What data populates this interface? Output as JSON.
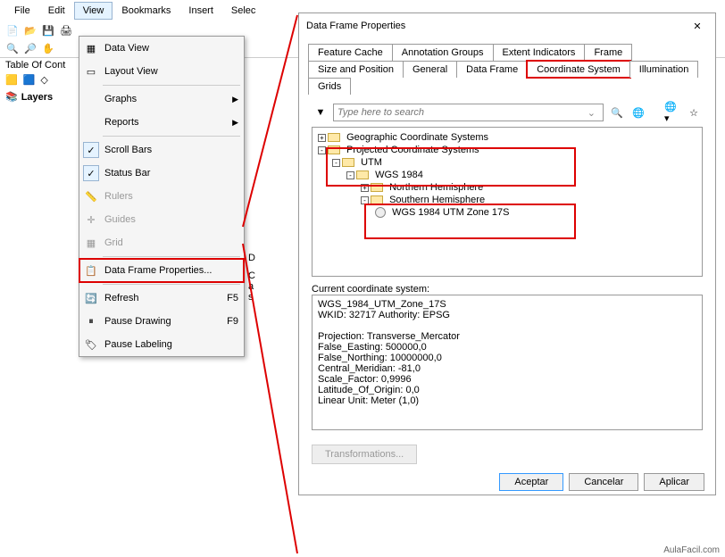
{
  "menubar": {
    "file": "File",
    "edit": "Edit",
    "view": "View",
    "bookmarks": "Bookmarks",
    "insert": "Insert",
    "select": "Selec"
  },
  "toc": {
    "title": "Table Of Cont",
    "layers": "Layers"
  },
  "view_menu": {
    "data_view": "Data View",
    "layout_view": "Layout View",
    "graphs": "Graphs",
    "reports": "Reports",
    "scroll_bars": "Scroll Bars",
    "status_bar": "Status Bar",
    "rulers": "Rulers",
    "guides": "Guides",
    "grid": "Grid",
    "dfp": "Data Frame Properties...",
    "refresh": "Refresh",
    "refresh_k": "F5",
    "pause_drawing": "Pause Drawing",
    "pause_drawing_k": "F9",
    "pause_labeling": "Pause Labeling"
  },
  "side_text": {
    "d": "D",
    "c": "C",
    "a": "a",
    "s": "s"
  },
  "dialog": {
    "title": "Data Frame Properties",
    "tabs": {
      "feature_cache": "Feature Cache",
      "annotation_groups": "Annotation Groups",
      "extent_indicators": "Extent Indicators",
      "frame": "Frame",
      "size_position": "Size and Position",
      "general": "General",
      "data_frame": "Data Frame",
      "coordinate_system": "Coordinate System",
      "illumination": "Illumination",
      "grids": "Grids"
    },
    "search_placeholder": "Type here to search",
    "tree": {
      "gcs": "Geographic Coordinate Systems",
      "pcs": "Projected Coordinate Systems",
      "utm": "UTM",
      "wgs1984": "WGS 1984",
      "north": "Northern Hemisphere",
      "south": "Southern Hemisphere",
      "zone": "WGS 1984 UTM Zone 17S"
    },
    "ccs_label": "Current coordinate system:",
    "ccs_text": "WGS_1984_UTM_Zone_17S\nWKID: 32717 Authority: EPSG\n\nProjection: Transverse_Mercator\nFalse_Easting: 500000,0\nFalse_Northing: 10000000,0\nCentral_Meridian: -81,0\nScale_Factor: 0,9996\nLatitude_Of_Origin: 0,0\nLinear Unit: Meter (1,0)",
    "transformations": "Transformations...",
    "accept": "Aceptar",
    "cancel": "Cancelar",
    "apply": "Aplicar"
  },
  "watermark": "AulaFacil.com"
}
